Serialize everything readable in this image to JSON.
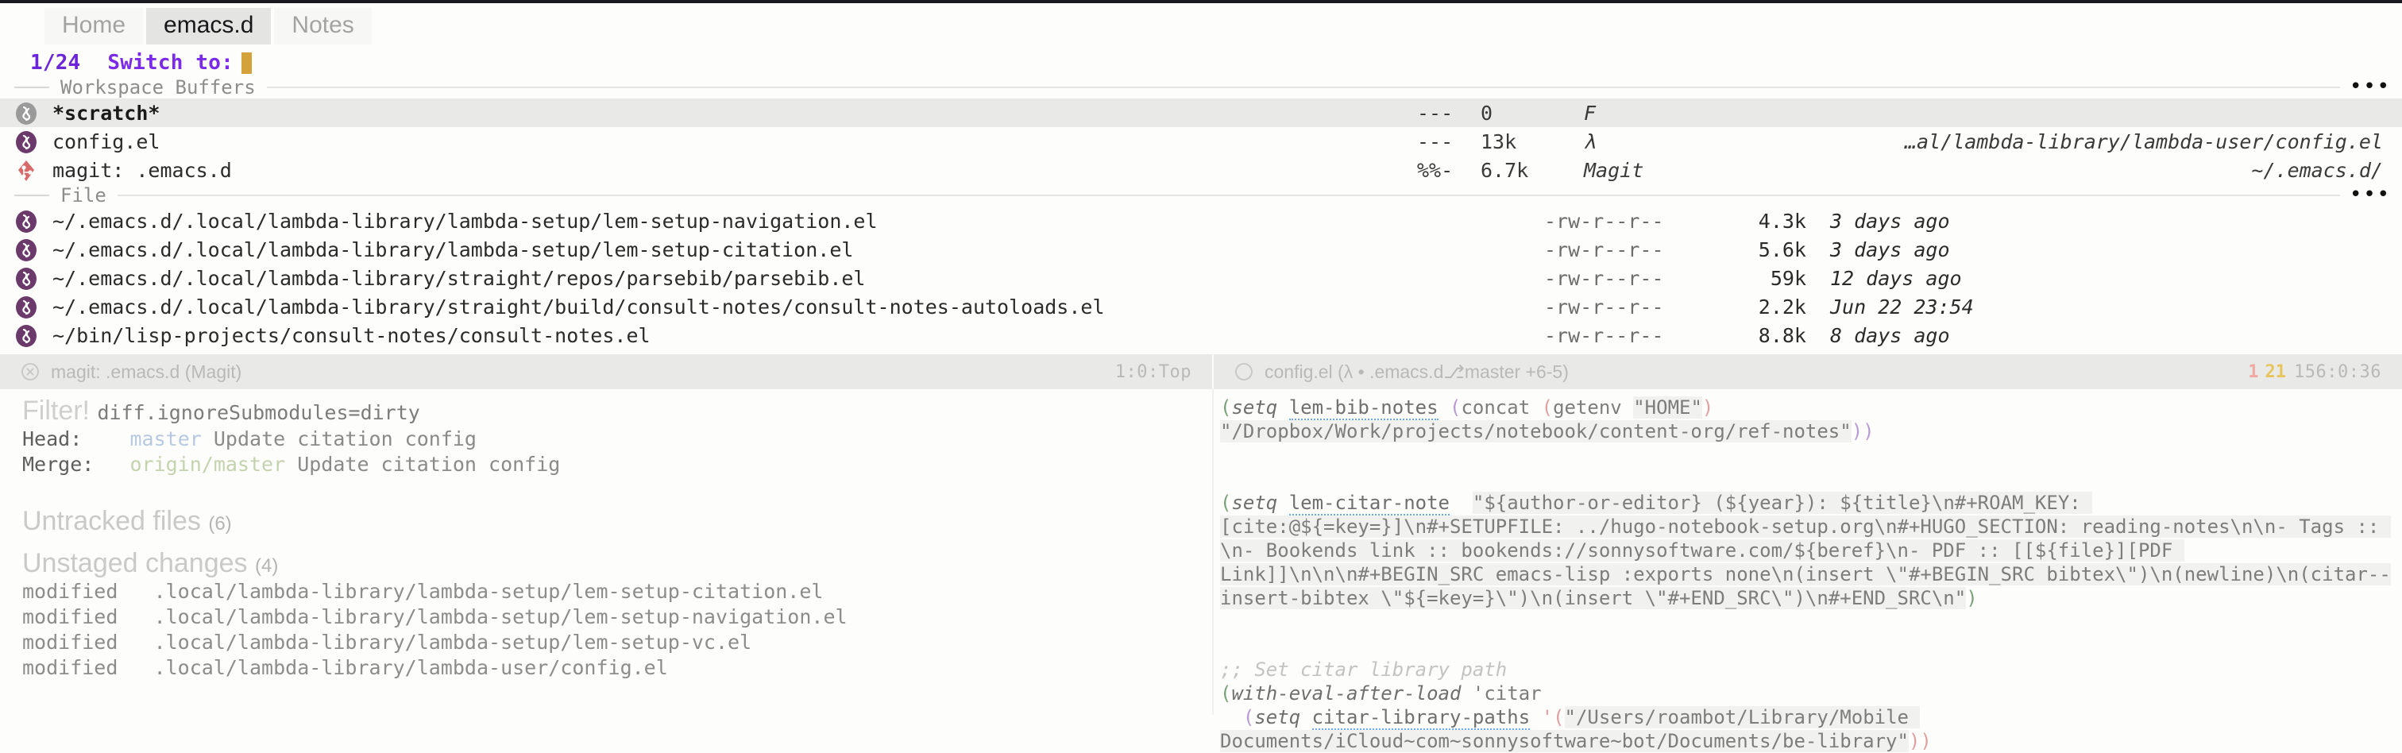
{
  "tabs": [
    {
      "label": "Home",
      "active": false
    },
    {
      "label": "emacs.d",
      "active": true
    },
    {
      "label": "Notes",
      "active": false
    }
  ],
  "minibuffer": {
    "count": "1/24",
    "prompt": "Switch to:",
    "input": ""
  },
  "groups": [
    {
      "title": "Workspace Buffers",
      "overflow": "•••"
    },
    {
      "title": "File",
      "overflow": "•••"
    }
  ],
  "workspace_buffers": [
    {
      "icon": "elisp-icon-gray",
      "name": "*scratch*",
      "modified": "---",
      "size": "0",
      "mode": "F",
      "path": "",
      "selected": true
    },
    {
      "icon": "elisp-icon",
      "name": "config.el",
      "modified": "---",
      "size": "13k",
      "mode": "λ",
      "path": "…al/lambda-library/lambda-user/config.el",
      "selected": false
    },
    {
      "icon": "magit-icon",
      "name": "magit: .emacs.d",
      "modified": "%%-",
      "size": "6.7k",
      "mode": "Magit",
      "path": "~/.emacs.d/",
      "selected": false
    }
  ],
  "file_candidates": [
    {
      "icon": "elisp-icon",
      "name": "~/.emacs.d/.local/lambda-library/lambda-setup/lem-setup-navigation.el",
      "perm": "-rw-r--r--",
      "size": "4.3k",
      "date": "3 days ago"
    },
    {
      "icon": "elisp-icon",
      "name": "~/.emacs.d/.local/lambda-library/lambda-setup/lem-setup-citation.el",
      "perm": "-rw-r--r--",
      "size": "5.6k",
      "date": "3 days ago"
    },
    {
      "icon": "elisp-icon",
      "name": "~/.emacs.d/.local/lambda-library/straight/repos/parsebib/parsebib.el",
      "perm": "-rw-r--r--",
      "size": "59k",
      "date": "12 days ago"
    },
    {
      "icon": "elisp-icon",
      "name": "~/.emacs.d/.local/lambda-library/straight/build/consult-notes/consult-notes-autoloads.el",
      "perm": "-rw-r--r--",
      "size": "2.2k",
      "date": "Jun 22 23:54"
    },
    {
      "icon": "elisp-icon",
      "name": "~/bin/lisp-projects/consult-notes/consult-notes.el",
      "perm": "-rw-r--r--",
      "size": "8.8k",
      "date": "8 days ago"
    }
  ],
  "modeline_left": {
    "icon": "circle-x-icon",
    "buffer": "magit: .emacs.d (Magit)",
    "position": "1:0:Top"
  },
  "modeline_right": {
    "icon": "circle-icon",
    "buffer": "config.el (λ • .emacs.d⎇master +6-5)",
    "errors": "1",
    "warnings": "21",
    "position": "156:0:36"
  },
  "magit": {
    "filter_label": "Filter!",
    "filter_value": "diff.ignoreSubmodules=dirty",
    "head_label": "Head:",
    "head_branch": "master",
    "head_message": "Update citation config",
    "merge_label": "Merge:",
    "merge_branch": "origin/master",
    "merge_message": "Update citation config",
    "untracked_title": "Untracked files",
    "untracked_count": "(6)",
    "unstaged_title": "Unstaged changes",
    "unstaged_count": "(4)",
    "unstaged": [
      {
        "status": "modified",
        "path": ".local/lambda-library/lambda-setup/lem-setup-citation.el"
      },
      {
        "status": "modified",
        "path": ".local/lambda-library/lambda-setup/lem-setup-navigation.el"
      },
      {
        "status": "modified",
        "path": ".local/lambda-library/lambda-setup/lem-setup-vc.el"
      },
      {
        "status": "modified",
        "path": ".local/lambda-library/lambda-user/config.el"
      }
    ]
  },
  "code": {
    "l1_open": "(",
    "l1_setq": "setq",
    "l1_sym": "lem-bib-notes",
    "l1_p2": "(",
    "l1_concat": "concat",
    "l1_p3": "(",
    "l1_getenv": "getenv",
    "l1_home": "\"HOME\"",
    "l1_close": ")",
    "l2_str": "\"/Dropbox/Work/projects/notebook/content-org/ref-notes\"",
    "l2_close": "))",
    "l4_open": "(",
    "l4_setq": "setq",
    "l4_sym": "lem-citar-note",
    "l4_str": "\"${author-or-editor} (${year}): ${title}\\n#+ROAM_KEY: [cite:@${=key=}]\\n#+SETUPFILE: ../hugo-notebook-setup.org\\n#+HUGO_SECTION: reading-notes\\n\\n- Tags :: \\n- Bookends link :: bookends://sonnysoftware.com/${beref}\\n- PDF :: [[${file}][PDF Link]]\\n\\n\\n#+BEGIN_SRC emacs-lisp :exports none\\n(insert \\\"#+BEGIN_SRC bibtex\\\")\\n(newline)\\n(citar--insert-bibtex \\\"${=key=}\\\")\\n(insert \\\"#+END_SRC\\\")\\n#+END_SRC\\n\"",
    "l4_close": ")",
    "comment": ";; Set citar library path",
    "l6_open": "(",
    "l6_kw": "with-eval-after-load",
    "l6_quote": "'citar",
    "l7_open": "(",
    "l7_setq": "setq",
    "l7_sym": "citar-library-paths",
    "l7_q": "'(",
    "l7_str": "\"/Users/roambot/Library/Mobile Documents/iCloud~com~sonnysoftware~bot/Documents/be-library\"",
    "l7_close": "))"
  },
  "colors": {
    "accent_purple": "#7a2ae8",
    "cursor_gold": "#d4a23a",
    "selected_row": "#e9e9e7",
    "modeline_bg": "#e9e9e7",
    "error_red": "#f0a8a0",
    "warn_yellow": "#e8c55c",
    "elisp_purple": "#6b3a6b",
    "magit_red": "#d86a6a"
  }
}
